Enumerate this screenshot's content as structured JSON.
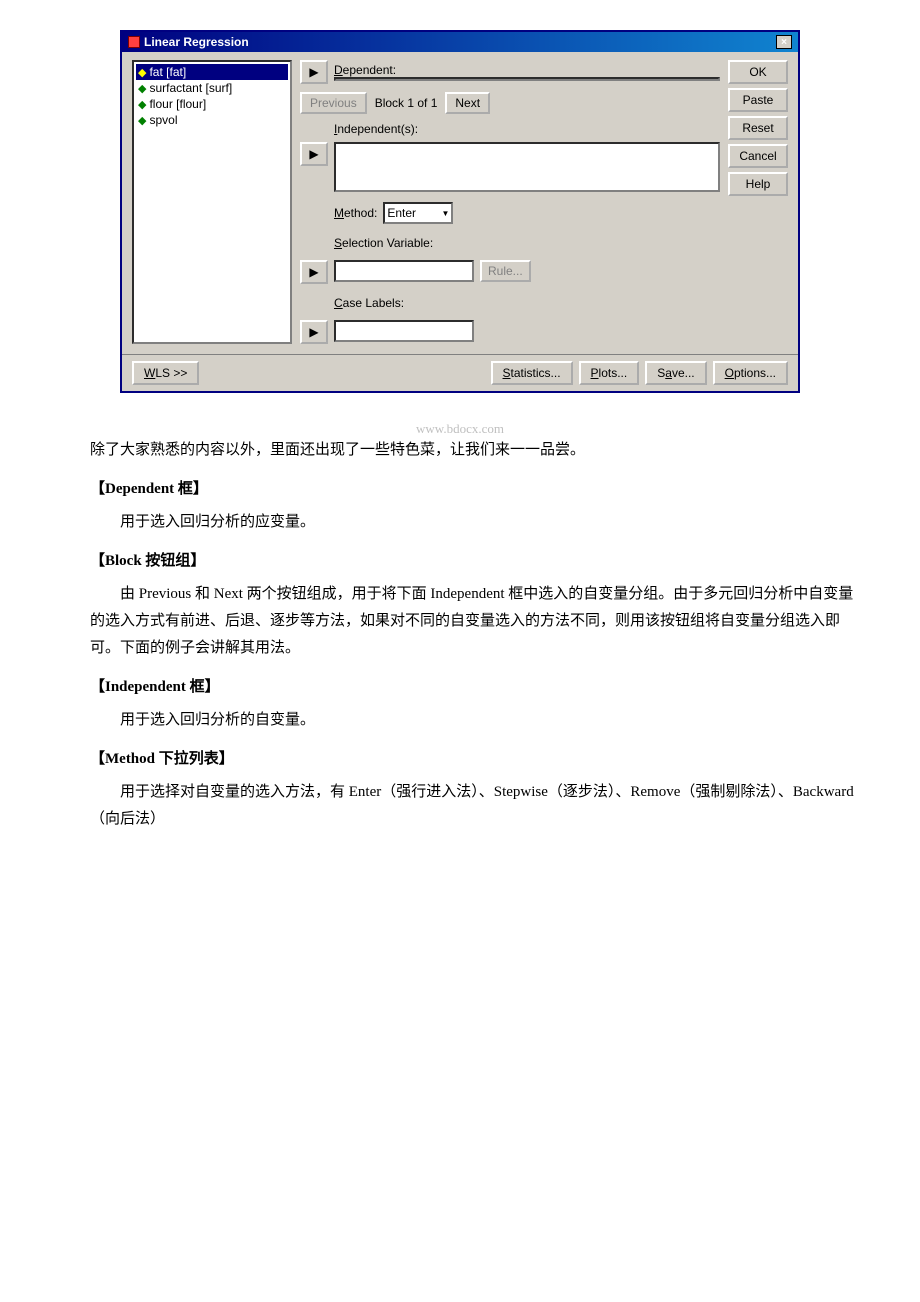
{
  "dialog": {
    "title": "Linear Regression",
    "close_label": "×",
    "variables": [
      {
        "name": "fat [fat]",
        "selected": true
      },
      {
        "name": "surfactant [surf]",
        "selected": false
      },
      {
        "name": "flour [flour]",
        "selected": false
      },
      {
        "name": "spvol",
        "selected": false
      }
    ],
    "dependent_label": "Dependent:",
    "dependent_value": "",
    "block_label": "Block 1 of 1",
    "previous_label": "Previous",
    "next_label": "Next",
    "independent_label": "Independent(s):",
    "independent_value": "",
    "method_label": "Method:",
    "method_value": "Enter",
    "selection_label": "Selection Variable:",
    "selection_value": "",
    "rule_label": "Rule...",
    "case_label": "Case Labels:",
    "case_value": "",
    "buttons": {
      "ok": "OK",
      "paste": "Paste",
      "reset": "Reset",
      "cancel": "Cancel",
      "help": "Help"
    },
    "footer": {
      "wls": "WLS >>",
      "statistics": "Statistics...",
      "plots": "Plots...",
      "save": "Save...",
      "options": "Options..."
    }
  },
  "watermark": "www.bdocx.com",
  "content": {
    "intro": "除了大家熟悉的内容以外，里面还出现了一些特色菜，让我们来一一品尝。",
    "sections": [
      {
        "header": "【Dependent 框】",
        "text": "用于选入回归分析的应变量。"
      },
      {
        "header": "【Block 按钮组】",
        "text": "由 Previous 和 Next 两个按钮组成，用于将下面 Independent 框中选入的自变量分组。由于多元回归分析中自变量的选入方式有前进、后退、逐步等方法，如果对不同的自变量选入的方法不同，则用该按钮组将自变量分组选入即可。下面的例子会讲解其用法。"
      },
      {
        "header": "【Independent 框】",
        "text": "用于选入回归分析的自变量。"
      },
      {
        "header": "【Method 下拉列表】",
        "text": "用于选择对自变量的选入方法，有 Enter（强行进入法）、Stepwise（逐步法）、Remove（强制剔除法）、Backward（向后法）"
      }
    ]
  }
}
